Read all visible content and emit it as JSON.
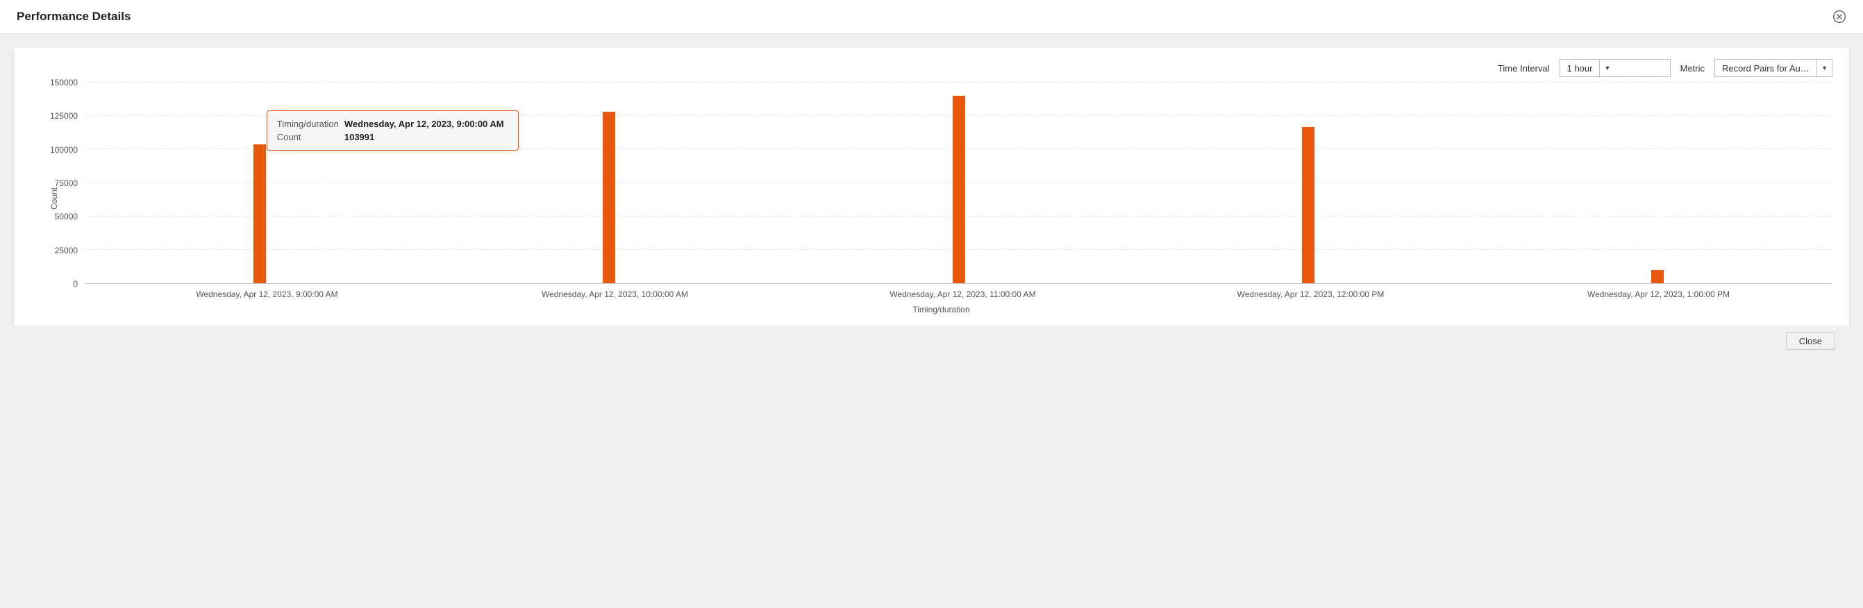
{
  "header": {
    "title": "Performance Details"
  },
  "controls": {
    "time_interval_label": "Time Interval",
    "time_interval_value": "1 hour",
    "metric_label": "Metric",
    "metric_value": "Record Pairs for Automate..."
  },
  "tooltip": {
    "row1_key": "Timing/duration",
    "row1_val": "Wednesday, Apr 12, 2023, 9:00:00 AM",
    "row2_key": "Count",
    "row2_val": "103991"
  },
  "footer": {
    "close_label": "Close"
  },
  "chart_data": {
    "type": "bar",
    "title": "",
    "xlabel": "Timing/duration",
    "ylabel": "Count",
    "ylim": [
      0,
      150000
    ],
    "yticks": [
      0,
      25000,
      50000,
      75000,
      100000,
      125000,
      150000
    ],
    "categories": [
      "Wednesday, Apr 12, 2023, 9:00:00 AM",
      "Wednesday, Apr 12, 2023, 10:00:00 AM",
      "Wednesday, Apr 12, 2023, 11:00:00 AM",
      "Wednesday, Apr 12, 2023, 12:00:00 PM",
      "Wednesday, Apr 12, 2023, 1:00:00 PM"
    ],
    "values": [
      103991,
      128000,
      140000,
      117000,
      10000
    ],
    "bar_color": "#e8590c"
  }
}
